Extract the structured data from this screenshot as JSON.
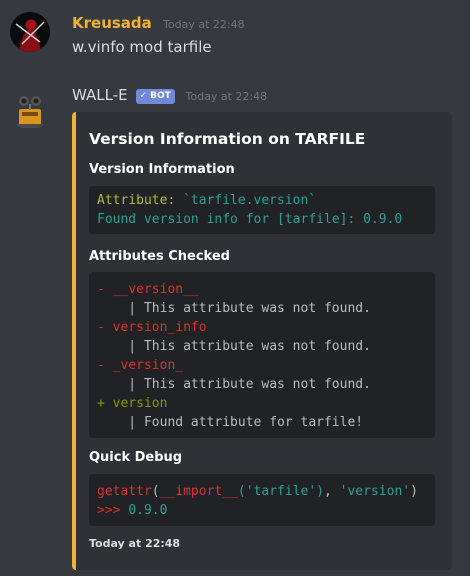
{
  "message1": {
    "username": "Kreusada",
    "username_color": "#f0b232",
    "timestamp": "Today at 22:48",
    "content": "w.vinfo mod tarfile"
  },
  "message2": {
    "username": "WALL-E",
    "bot_tag": "✓ BOT",
    "timestamp": "Today at 22:48",
    "embed": {
      "accent_color": "#f0b232",
      "title": "Version Information on TARFILE",
      "field1": {
        "name": "Version Information",
        "line1": {
          "label": "Attribute: ",
          "value": "`tarfile.version`"
        },
        "line2": {
          "prefix": "Found version info for [",
          "name": "tarfile",
          "suffix": "]: 0.9.0"
        }
      },
      "field2": {
        "name": "Attributes Checked",
        "lines": [
          {
            "marker": "- ",
            "text": "__version__"
          },
          {
            "indent": "    | ",
            "text": "This attribute was not found."
          },
          {
            "marker": "- ",
            "text": "version_info"
          },
          {
            "indent": "    | ",
            "text": "This attribute was not found."
          },
          {
            "marker": "- ",
            "text": "_version_"
          },
          {
            "indent": "    | ",
            "text": "This attribute was not found."
          },
          {
            "marker": "+ ",
            "text": "version"
          },
          {
            "indent": "    | ",
            "text": "Found attribute for tarfile!"
          }
        ]
      },
      "field3": {
        "name": "Quick Debug",
        "code_fn": "getattr",
        "code_open": "(",
        "code_import": "__import__",
        "code_arg1": "('tarfile')",
        "code_sep": ", ",
        "code_arg2": "'version'",
        "code_close": ")",
        "result_prompt": ">>> ",
        "result_value": "0.9.0"
      },
      "footer": "Today at 22:48"
    }
  }
}
